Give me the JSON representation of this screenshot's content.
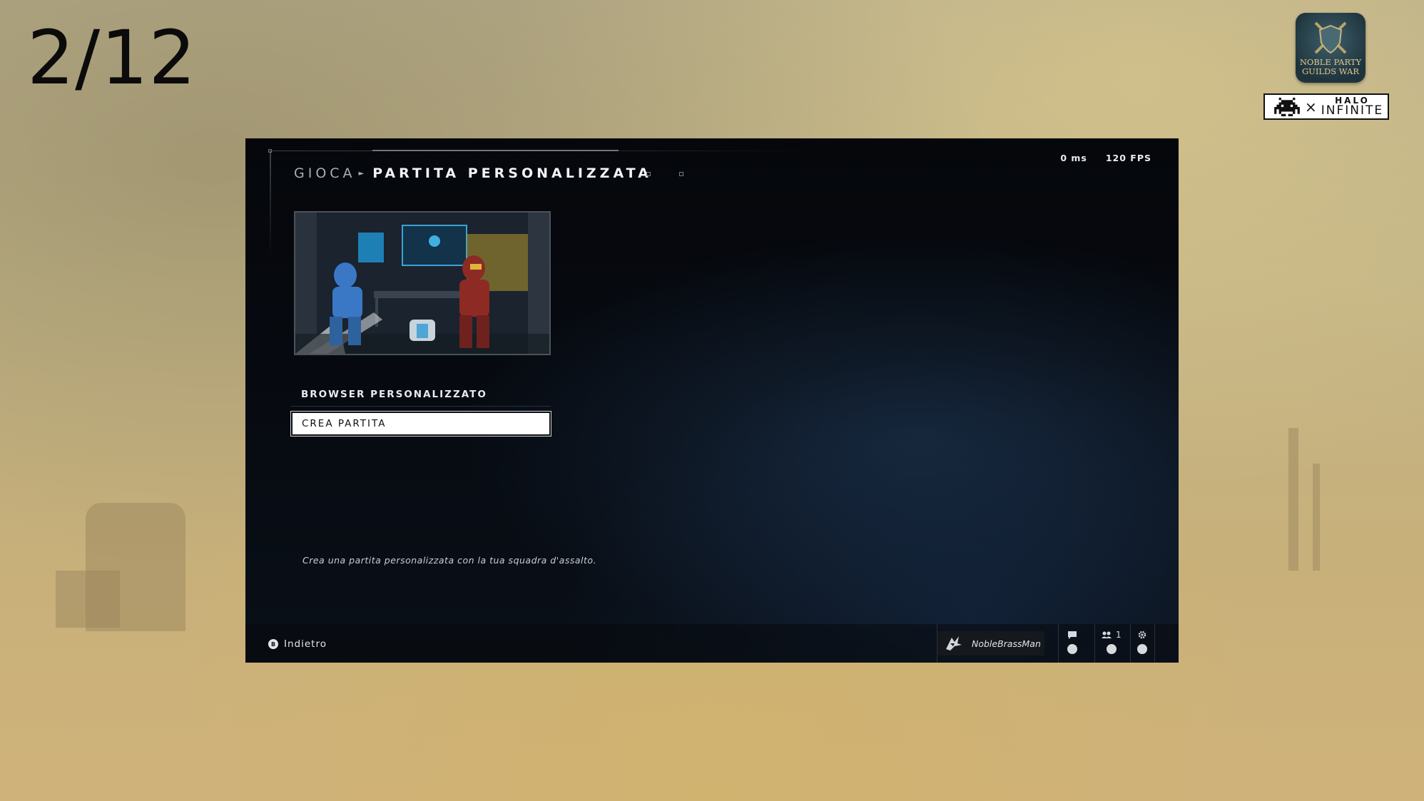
{
  "slide": {
    "number": "2/12"
  },
  "branding": {
    "guild_logo_line1": "NOBLE PARTY",
    "guild_logo_line2": "GUILDS WAR",
    "collab_separator": "×",
    "halo_word": "HALO",
    "infinite_word": "INFINITE"
  },
  "game": {
    "breadcrumb": "GIOCA",
    "title": "PARTITA PERSONALIZZATA",
    "stats": {
      "ping": "0 ms",
      "fps": "120 FPS"
    },
    "menu": [
      {
        "label": "BROWSER PERSONALIZZATO",
        "selected": false
      },
      {
        "label": "CREA PARTITA",
        "selected": true
      }
    ],
    "description": "Crea una partita personalizzata con la tua squadra d'assalto.",
    "footer": {
      "back_button_glyph": "B",
      "back_label": "Indietro",
      "gamertag": "NobleBrassMan",
      "party_count": "1"
    }
  },
  "colors": {
    "background_sand": "#c2b487",
    "panel_bg": "#05070b",
    "selected_bg": "#ffffff",
    "text_primary": "#f1f3f5",
    "blue_armor": "#3a78c6",
    "red_armor": "#8e2a24"
  },
  "icons": [
    "guild-shield-icon",
    "space-invader-icon",
    "emblem-icon",
    "chat-icon",
    "party-icon",
    "gear-icon"
  ]
}
